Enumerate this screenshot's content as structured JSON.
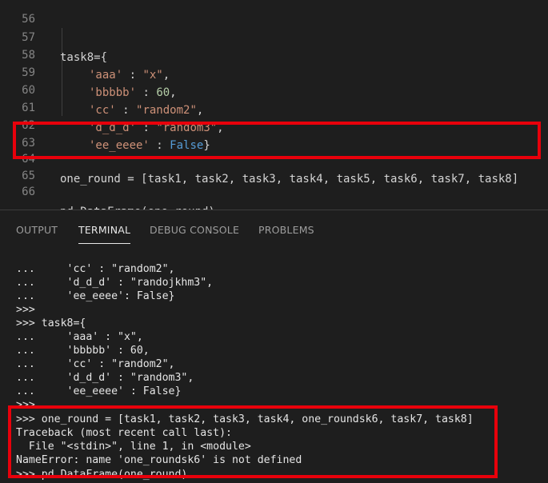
{
  "editor": {
    "lines": [
      {
        "num": "56",
        "text": ""
      },
      {
        "num": "57",
        "text": "task8={"
      },
      {
        "num": "58",
        "key": "'aaa'",
        "sep": " : ",
        "val": "\"x\"",
        "end": ","
      },
      {
        "num": "59",
        "key": "'bbbbb'",
        "sep": " : ",
        "val": "60",
        "end": ","
      },
      {
        "num": "60",
        "key": "'cc'",
        "sep": " : ",
        "val": "\"random2\"",
        "end": ","
      },
      {
        "num": "61",
        "key": "'d_d_d'",
        "sep": " : ",
        "val": "\"random3\"",
        "end": ","
      },
      {
        "num": "62",
        "key": "'ee_eeee'",
        "sep": " : ",
        "val": "False",
        "end": "}"
      },
      {
        "num": "63",
        "text": ""
      },
      {
        "num": "64",
        "text": "one_round = [task1, task2, task3, task4, task5, task6, task7, task8]"
      },
      {
        "num": "65",
        "text": ""
      },
      {
        "num": "66",
        "text": "pd.DataFrame(one_round)"
      }
    ]
  },
  "panel": {
    "tabs": [
      {
        "label": "OUTPUT"
      },
      {
        "label": "TERMINAL"
      },
      {
        "label": "DEBUG CONSOLE"
      },
      {
        "label": "PROBLEMS"
      }
    ],
    "active_tab": "TERMINAL"
  },
  "terminal": {
    "lines": [
      "...     'cc' : \"random2\",",
      "...     'd_d_d' : \"randojkhm3\",",
      "...     'ee_eeee': False}",
      ">>>",
      ">>> task8={",
      "...     'aaa' : \"x\",",
      "...     'bbbbb' : 60,",
      "...     'cc' : \"random2\",",
      "...     'd_d_d' : \"random3\",",
      "...     'ee_eeee' : False}",
      ">>>",
      ">>> one_round = [task1, task2, task3, task4, one_roundsk6, task7, task8]",
      "Traceback (most recent call last):",
      "  File \"<stdin>\", line 1, in <module>",
      "NameError: name 'one_roundsk6' is not defined",
      ">>> pd.DataFrame(one_round)"
    ]
  },
  "colors": {
    "background": "#1e1e1e",
    "highlight_box": "#e8000b",
    "string": "#ce9178",
    "number": "#b5cea8",
    "keyword": "#569cd6"
  }
}
